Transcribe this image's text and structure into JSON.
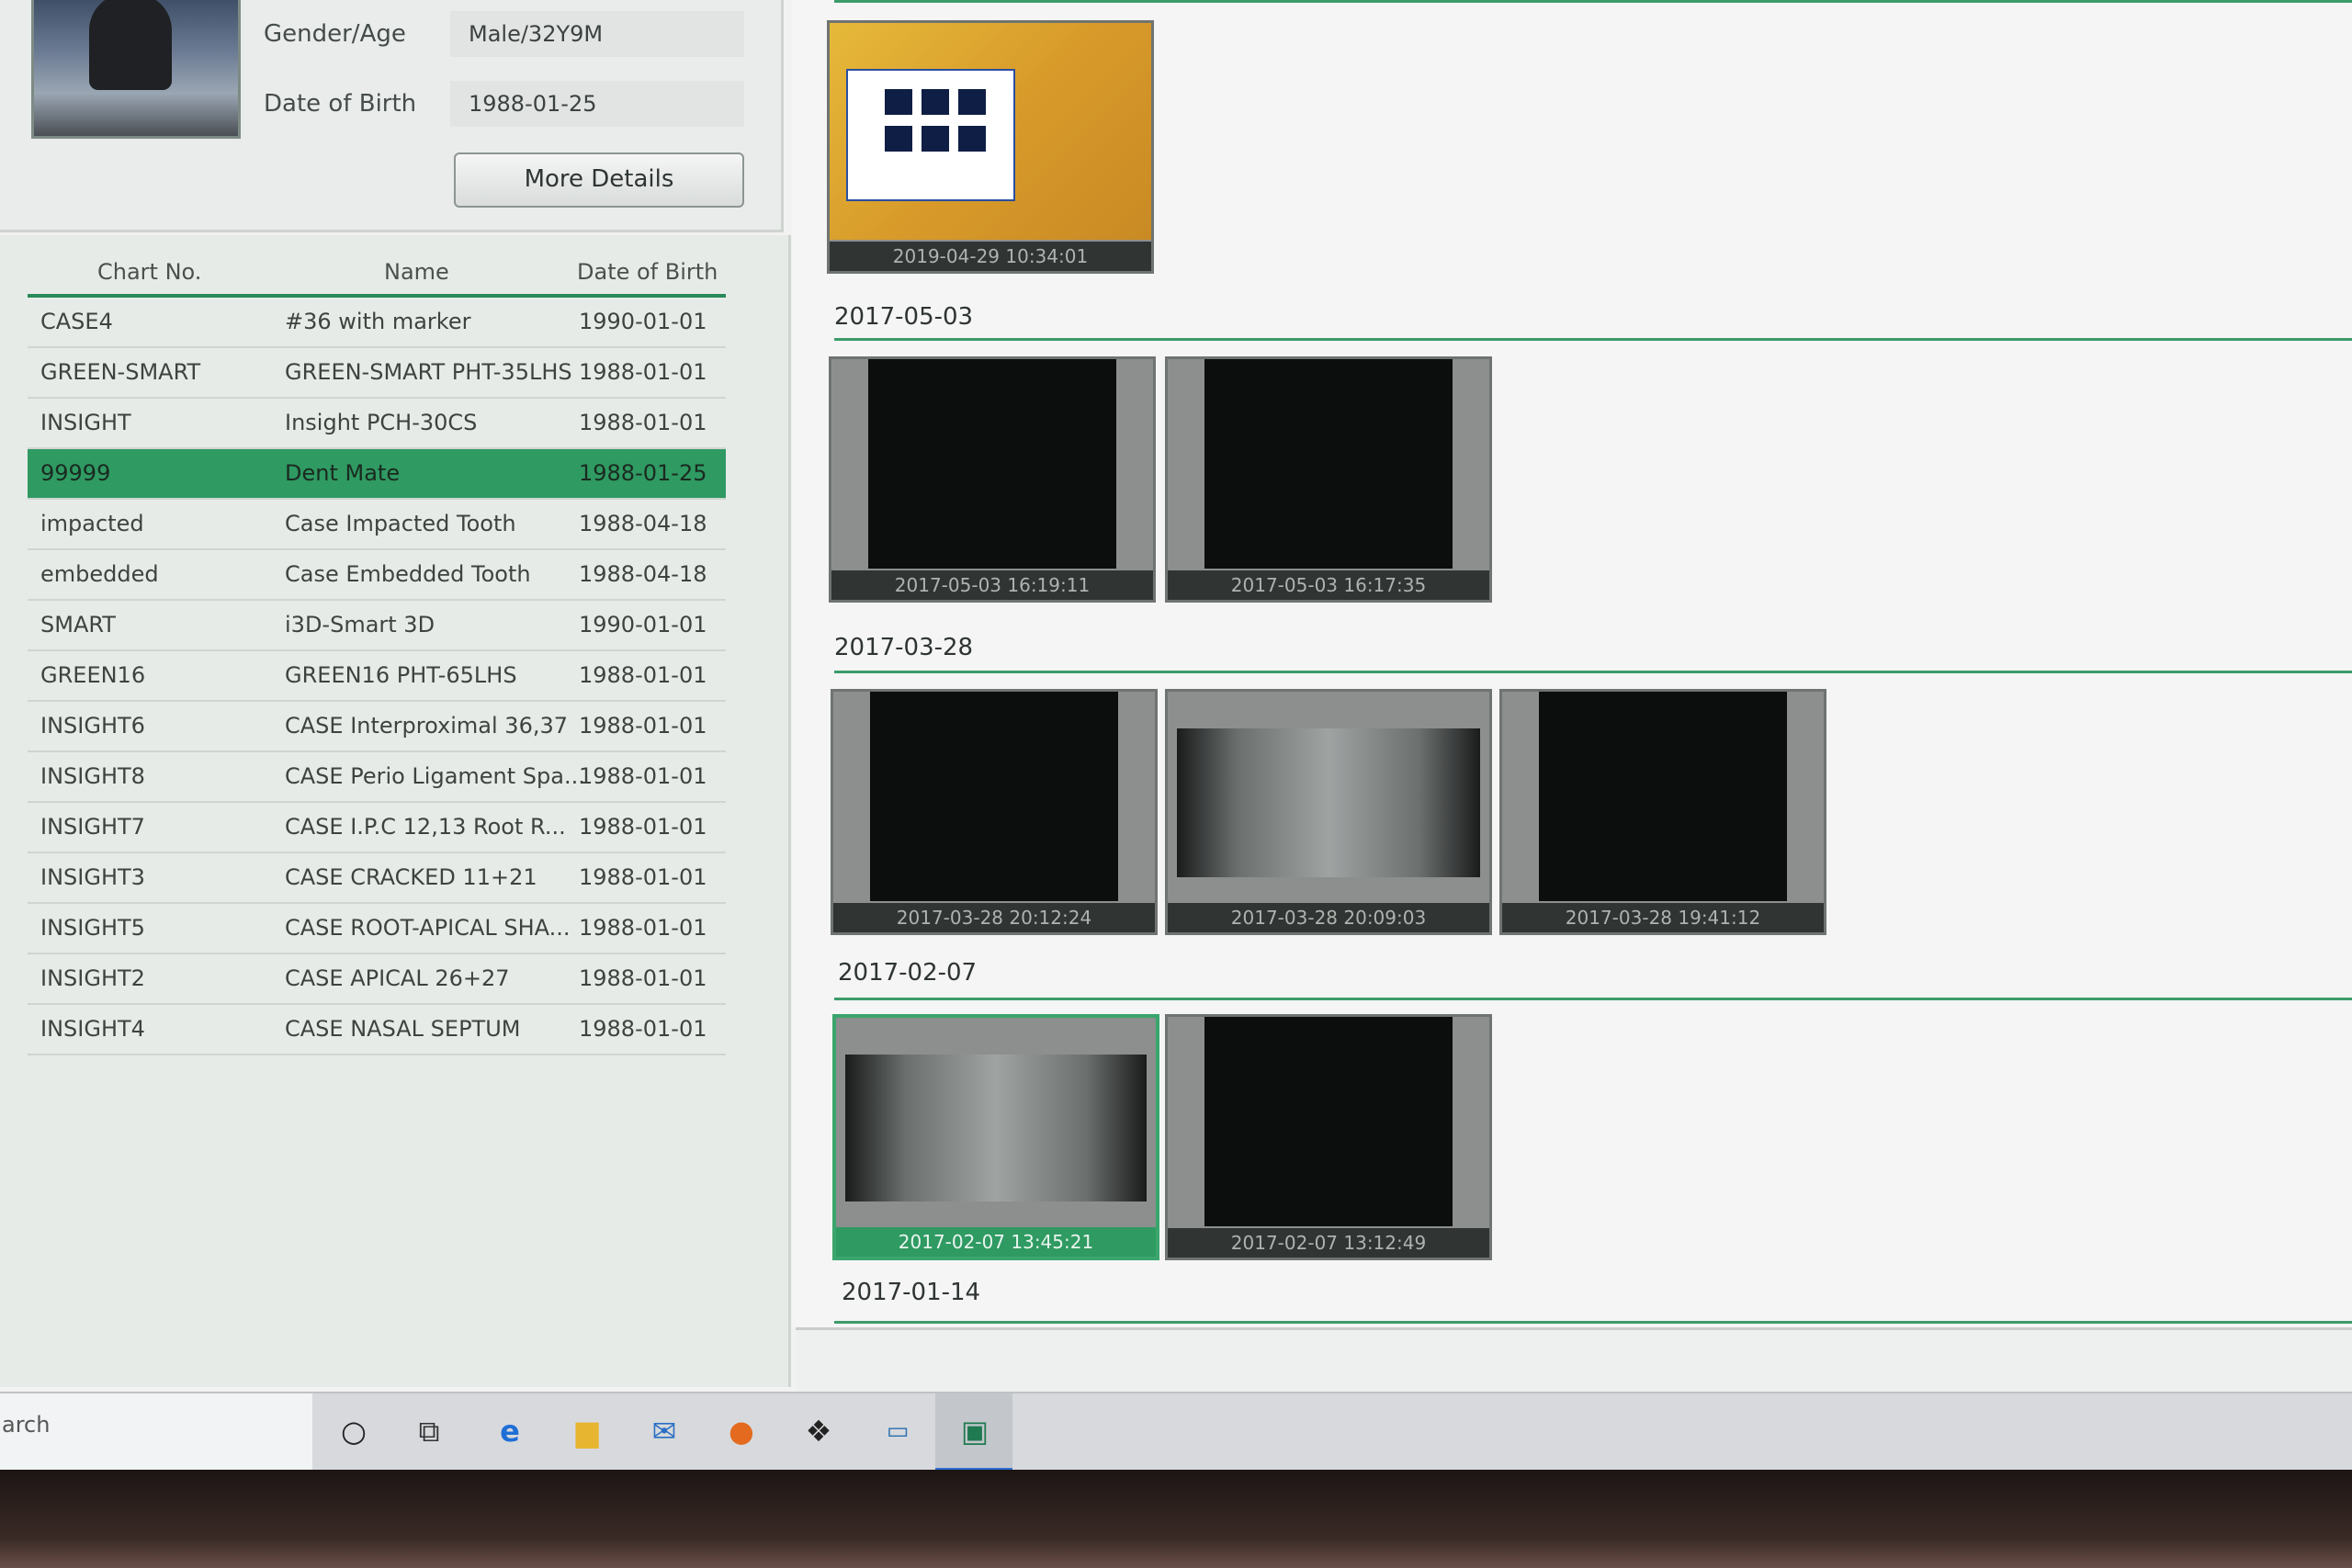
{
  "patient_info": {
    "gender_age_label": "Gender/Age",
    "gender_age_value": "Male/32Y9M",
    "dob_label": "Date of Birth",
    "dob_value": "1988-01-25",
    "more_details_label": "More Details"
  },
  "patient_list": {
    "headers": [
      "Chart No.",
      "Name",
      "Date of Birth"
    ],
    "rows": [
      {
        "chart": "CASE4",
        "name": "#36 with marker",
        "dob": "1990-01-01"
      },
      {
        "chart": "GREEN-SMART",
        "name": "GREEN-SMART PHT-35LHS",
        "dob": "1988-01-01"
      },
      {
        "chart": "INSIGHT",
        "name": "Insight PCH-30CS",
        "dob": "1988-01-01"
      },
      {
        "chart": "99999",
        "name": "Dent Mate",
        "dob": "1988-01-25"
      },
      {
        "chart": "impacted",
        "name": "Case Impacted Tooth",
        "dob": "1988-04-18"
      },
      {
        "chart": "embedded",
        "name": "Case Embedded Tooth",
        "dob": "1988-04-18"
      },
      {
        "chart": "SMART",
        "name": "i3D-Smart 3D",
        "dob": "1990-01-01"
      },
      {
        "chart": "GREEN16",
        "name": "GREEN16 PHT-65LHS",
        "dob": "1988-01-01"
      },
      {
        "chart": "INSIGHT6",
        "name": "CASE Interproximal 36,37",
        "dob": "1988-01-01"
      },
      {
        "chart": "INSIGHT8",
        "name": "CASE Perio Ligament Spa...",
        "dob": "1988-01-01"
      },
      {
        "chart": "INSIGHT7",
        "name": "CASE I.P.C 12,13 Root R...",
        "dob": "1988-01-01"
      },
      {
        "chart": "INSIGHT3",
        "name": "CASE CRACKED 11+21",
        "dob": "1988-01-01"
      },
      {
        "chart": "INSIGHT5",
        "name": "CASE ROOT-APICAL SHA...",
        "dob": "1988-01-01"
      },
      {
        "chart": "INSIGHT2",
        "name": "CASE APICAL 26+27",
        "dob": "1988-01-01"
      },
      {
        "chart": "INSIGHT4",
        "name": "CASE NASAL SEPTUM",
        "dob": "1988-01-01"
      }
    ],
    "selected_chart": "99999"
  },
  "gallery": {
    "groups": [
      {
        "date": "",
        "images": [
          {
            "timestamp": "2019-04-29 10:34:01",
            "kind": "screenshot"
          }
        ]
      },
      {
        "date": "2017-05-03",
        "images": [
          {
            "timestamp": "2017-05-03 16:19:11",
            "kind": "ct-slice"
          },
          {
            "timestamp": "2017-05-03 16:17:35",
            "kind": "ct-axial"
          }
        ]
      },
      {
        "date": "2017-03-28",
        "images": [
          {
            "timestamp": "2017-03-28 20:12:24",
            "kind": "cephalometric"
          },
          {
            "timestamp": "2017-03-28 20:09:03",
            "kind": "panoramic"
          },
          {
            "timestamp": "2017-03-28 19:41:12",
            "kind": "ct-axial"
          }
        ]
      },
      {
        "date": "2017-02-07",
        "images": [
          {
            "timestamp": "2017-02-07 13:45:21",
            "kind": "panoramic",
            "selected": true
          },
          {
            "timestamp": "2017-02-07 13:12:49",
            "kind": "ct-axial"
          }
        ]
      },
      {
        "date": "2017-01-14",
        "images": []
      }
    ]
  },
  "taskbar": {
    "search_text": "arch",
    "icons": [
      "cortana-icon",
      "task-view-icon",
      "edge-icon",
      "file-explorer-icon",
      "mail-icon",
      "firefox-icon",
      "dropbox-icon",
      "amazon-icon",
      "dental-app-icon"
    ]
  },
  "colors": {
    "accent_green": "#2f9a62",
    "separator_green": "#3c9b6a"
  }
}
